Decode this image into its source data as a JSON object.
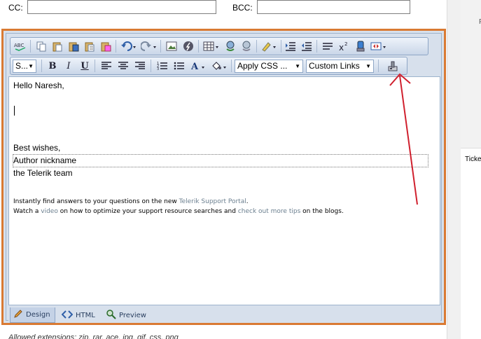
{
  "form": {
    "cc_label": "CC:",
    "bcc_label": "BCC:",
    "cc_value": "",
    "bcc_value": ""
  },
  "toolbar2": {
    "format_select": "S...",
    "css_select": "Apply CSS ...",
    "links_select": "Custom Links"
  },
  "content": {
    "greeting": "Hello Naresh,",
    "closing": "Best wishes,",
    "nickname": "Author nickname",
    "team": "the Telerik team",
    "line1_a": "Instantly find answers to your questions on the new ",
    "line1_link": "Telerik Support Portal",
    "line1_b": ".",
    "line2_a": "Watch a ",
    "line2_link1": "video",
    "line2_b": " on how to optimize your support resource searches and ",
    "line2_link2": "check out more tips",
    "line2_c": " on the blogs."
  },
  "modes": {
    "design": "Design",
    "html": "HTML",
    "preview": "Preview"
  },
  "footer": {
    "allowed": "Allowed extensions: zip, rar, ace, jpg, gif, css, png"
  },
  "right_pane": {
    "label": "Ticke",
    "char": "F"
  },
  "colors": {
    "frame_border": "#d97a33",
    "annotation_arrow": "#d0202e",
    "toolbar_bg": "#d7e0ec"
  },
  "icons": [
    "spellcheck-icon",
    "copy-icon",
    "paste-icon",
    "paste-word-icon",
    "paste-text-icon",
    "paste-html-icon",
    "undo-icon",
    "redo-icon",
    "image-manager-icon",
    "flash-manager-icon",
    "table-icon",
    "link-icon",
    "unlink-icon",
    "format-stripper-icon",
    "indent-icon",
    "outdent-icon",
    "align-icon",
    "superscript-icon",
    "media-icon",
    "module-icon",
    "bold-icon",
    "italic-icon",
    "underline-icon",
    "align-left-icon",
    "align-center-icon",
    "align-right-icon",
    "numbered-list-icon",
    "bullet-list-icon",
    "font-color-icon",
    "background-color-icon",
    "custom-tool-icon"
  ]
}
